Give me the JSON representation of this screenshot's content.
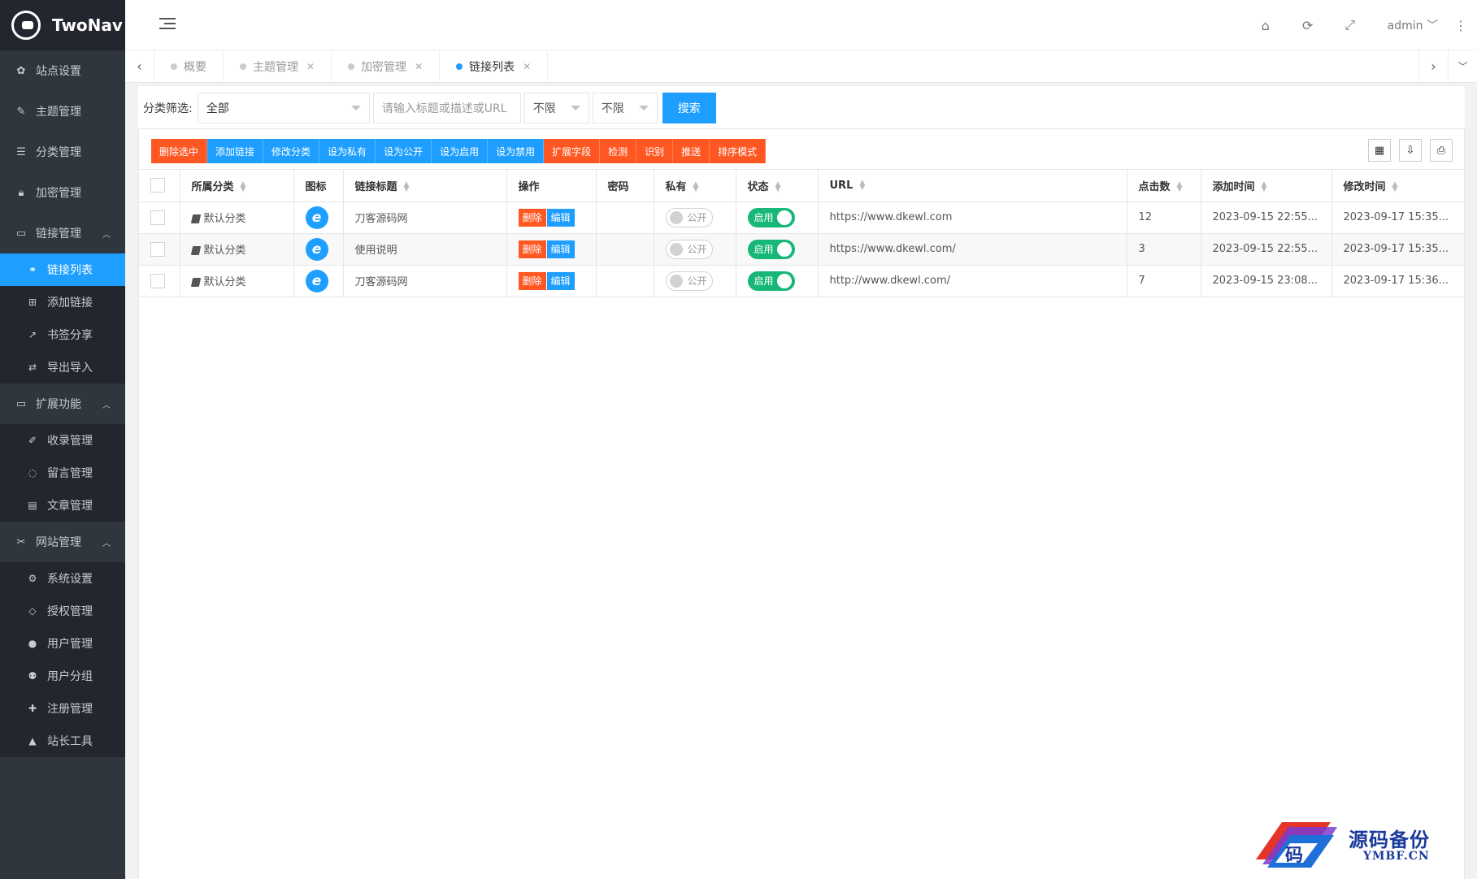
{
  "app": {
    "name": "TwoNav"
  },
  "sidebar": {
    "items": [
      {
        "label": "站点设置",
        "icon": "gear-icon"
      },
      {
        "label": "主题管理",
        "icon": "wand-icon"
      },
      {
        "label": "分类管理",
        "icon": "list-icon"
      },
      {
        "label": "加密管理",
        "icon": "lock-icon"
      }
    ],
    "group_links": {
      "label": "链接管理",
      "items": [
        {
          "label": "链接列表",
          "icon": "link-icon"
        },
        {
          "label": "添加链接",
          "icon": "plus-square-icon"
        },
        {
          "label": "书签分享",
          "icon": "share-icon"
        },
        {
          "label": "导出导入",
          "icon": "swap-icon"
        }
      ]
    },
    "group_ext": {
      "label": "扩展功能",
      "items": [
        {
          "label": "收录管理",
          "icon": "pencil-icon"
        },
        {
          "label": "留言管理",
          "icon": "comment-icon"
        },
        {
          "label": "文章管理",
          "icon": "document-icon"
        }
      ]
    },
    "group_site": {
      "label": "网站管理",
      "items": [
        {
          "label": "系统设置",
          "icon": "cogs-icon"
        },
        {
          "label": "授权管理",
          "icon": "diamond-icon"
        },
        {
          "label": "用户管理",
          "icon": "user-icon"
        },
        {
          "label": "用户分组",
          "icon": "users-icon"
        },
        {
          "label": "注册管理",
          "icon": "user-plus-icon"
        },
        {
          "label": "站长工具",
          "icon": "warning-icon"
        }
      ]
    }
  },
  "header": {
    "user": "admin"
  },
  "tabs": [
    {
      "label": "概要"
    },
    {
      "label": "主题管理"
    },
    {
      "label": "加密管理"
    },
    {
      "label": "链接列表"
    }
  ],
  "filters": {
    "label": "分类筛选:",
    "category": "全部",
    "search_placeholder": "请输入标题或描述或URL",
    "select2": "不限",
    "select3": "不限",
    "search_button": "搜索"
  },
  "toolbar": {
    "buttons": [
      {
        "label": "删除选中",
        "color": "#ff5722"
      },
      {
        "label": "添加链接",
        "color": "#1e9fff"
      },
      {
        "label": "修改分类",
        "color": "#1e9fff"
      },
      {
        "label": "设为私有",
        "color": "#1e9fff"
      },
      {
        "label": "设为公开",
        "color": "#1e9fff"
      },
      {
        "label": "设为启用",
        "color": "#1e9fff"
      },
      {
        "label": "设为禁用",
        "color": "#1e9fff"
      },
      {
        "label": "扩展字段",
        "color": "#ff5722"
      },
      {
        "label": "检测",
        "color": "#ff5722"
      },
      {
        "label": "识别",
        "color": "#ff5722"
      },
      {
        "label": "推送",
        "color": "#ff5722"
      },
      {
        "label": "排序模式",
        "color": "#ff5722"
      }
    ]
  },
  "table": {
    "headers": [
      "所属分类",
      "图标",
      "链接标题",
      "操作",
      "密码",
      "私有",
      "状态",
      "URL",
      "点击数",
      "添加时间",
      "修改时间"
    ],
    "op_delete": "删除",
    "op_edit": "编辑",
    "private_label": "公开",
    "status_label": "启用",
    "rows": [
      {
        "category": "默认分类",
        "title": "刀客源码网",
        "url": "https://www.dkewl.com",
        "clicks": "12",
        "added": "2023-09-15 22:55...",
        "modified": "2023-09-17 15:35..."
      },
      {
        "category": "默认分类",
        "title": "使用说明",
        "url": "https://www.dkewl.com/",
        "clicks": "3",
        "added": "2023-09-15 22:55...",
        "modified": "2023-09-17 15:35..."
      },
      {
        "category": "默认分类",
        "title": "刀客源码网",
        "url": "http://www.dkewl.com/",
        "clicks": "7",
        "added": "2023-09-15 23:08...",
        "modified": "2023-09-17 15:36..."
      }
    ]
  },
  "watermark": {
    "cn": "源码备份",
    "en": "YMBF.CN"
  }
}
